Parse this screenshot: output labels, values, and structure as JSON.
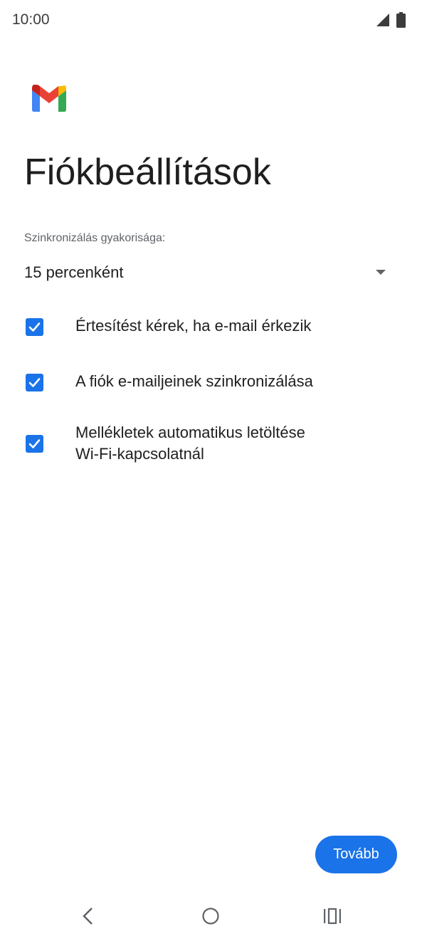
{
  "status_bar": {
    "time": "10:00",
    "signal_icon": "signal-icon",
    "battery_icon": "battery-icon"
  },
  "logo": {
    "icon": "gmail-logo-icon",
    "colors": [
      "#EA4335",
      "#4285F4",
      "#34A853",
      "#FBBC04"
    ]
  },
  "title": "Fiókbeállítások",
  "sync": {
    "label": "Szinkronizálás gyakorisága:",
    "value": "15 percenként",
    "icon": "dropdown-arrow-icon"
  },
  "options": [
    {
      "label": "Értesítést kérek, ha e-mail érkezik",
      "checked": true
    },
    {
      "label": "A fiók e-mailjeinek szinkronizálása",
      "checked": true
    },
    {
      "label_line1": "Mellékletek automatikus letöltése",
      "label_line2": "Wi-Fi-kapcsolatnál",
      "checked": true
    }
  ],
  "next_button": {
    "label": "Tovább"
  },
  "nav": {
    "back": "back-icon",
    "home": "home-icon",
    "recents": "recents-icon"
  },
  "colors": {
    "accent": "#1a73e8",
    "text": "#1f1f1f",
    "secondary_text": "#5f6368"
  }
}
